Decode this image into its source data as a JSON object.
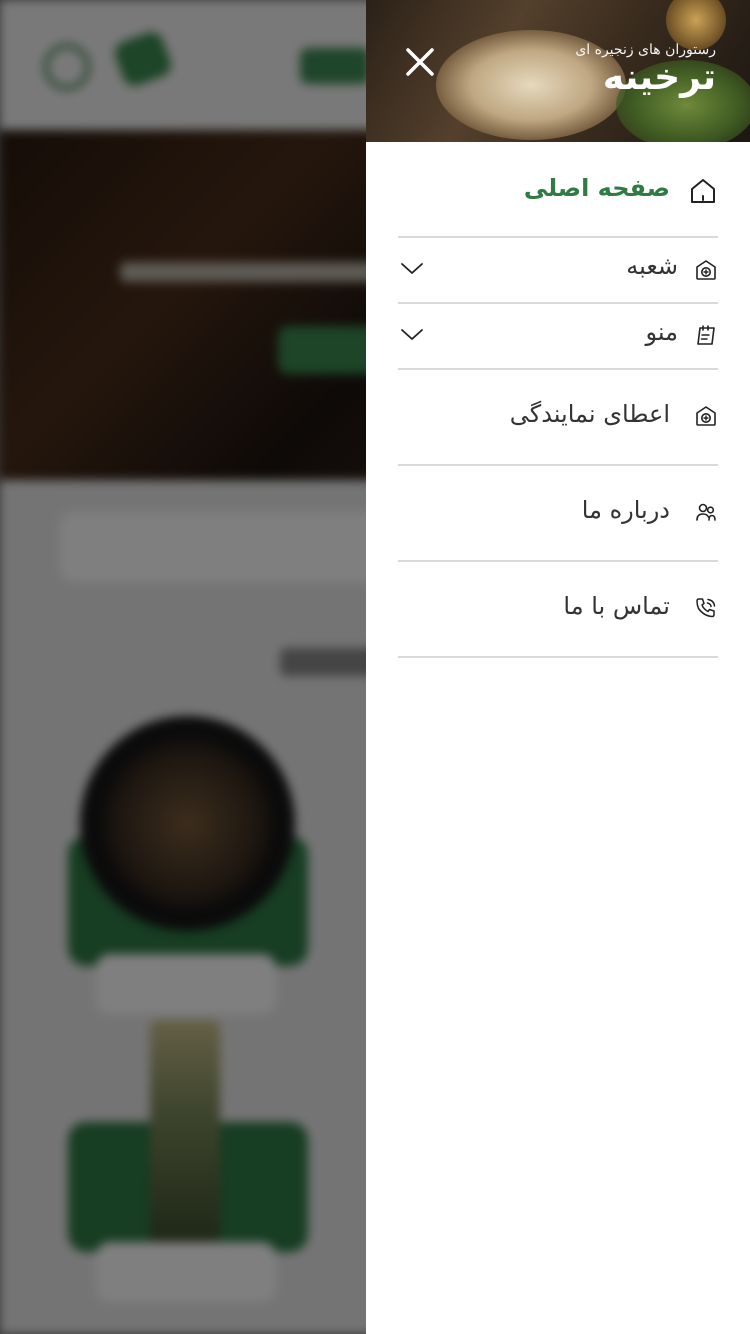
{
  "brand": {
    "tagline": "رستوران های زنجیره ای",
    "name": "ترخینه"
  },
  "colors": {
    "accent": "#2f7a45",
    "text": "#333333",
    "divider": "#d9d9d9"
  },
  "drawer": {
    "close_icon": "close-icon",
    "items": [
      {
        "label": "صفحه اصلی",
        "icon": "home-icon",
        "active": true,
        "expandable": false
      },
      {
        "label": "شعبه",
        "icon": "branch-icon",
        "active": false,
        "expandable": true
      },
      {
        "label": "منو",
        "icon": "menu-book-icon",
        "active": false,
        "expandable": true
      },
      {
        "label": "اعطای نمایندگی",
        "icon": "agency-icon",
        "active": false,
        "expandable": false
      },
      {
        "label": "درباره ما",
        "icon": "users-icon",
        "active": false,
        "expandable": false
      },
      {
        "label": "تماس با ما",
        "icon": "phone-icon",
        "active": false,
        "expandable": false
      }
    ]
  }
}
